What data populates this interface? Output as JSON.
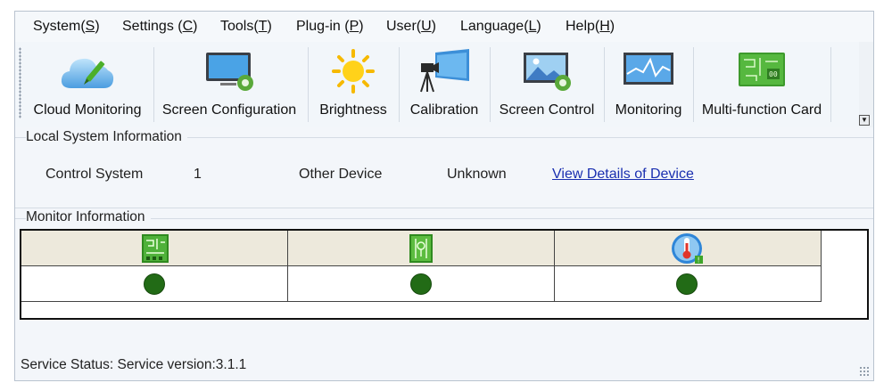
{
  "menu": [
    {
      "pre": "System(",
      "key": "S",
      "post": ")"
    },
    {
      "pre": "Settings (",
      "key": "C",
      "post": ")"
    },
    {
      "pre": "Tools(",
      "key": "T",
      "post": ")"
    },
    {
      "pre": "Plug-in (",
      "key": "P",
      "post": ")"
    },
    {
      "pre": "User(",
      "key": "U",
      "post": ")"
    },
    {
      "pre": "Language(",
      "key": "L",
      "post": ")"
    },
    {
      "pre": "Help(",
      "key": "H",
      "post": ")"
    }
  ],
  "toolbar": {
    "items": [
      {
        "label": "Cloud Monitoring",
        "icon": "cloud-pen-icon"
      },
      {
        "label": "Screen Configuration",
        "icon": "monitor-gear-icon"
      },
      {
        "label": "Brightness",
        "icon": "sun-icon"
      },
      {
        "label": "Calibration",
        "icon": "camera-tripod-icon"
      },
      {
        "label": "Screen Control",
        "icon": "picture-gear-icon"
      },
      {
        "label": "Monitoring",
        "icon": "waveform-monitor-icon"
      },
      {
        "label": "Multi-function Card",
        "icon": "circuit-board-icon"
      }
    ],
    "overflow_glyph": "▼"
  },
  "local_system": {
    "title": "Local System Information",
    "control_system_label": "Control System",
    "control_system_value": "1",
    "other_device_label": "Other Device",
    "other_device_value": "Unknown",
    "view_details_link": "View Details of Device"
  },
  "monitor": {
    "title": "Monitor Information",
    "columns": [
      {
        "icon": "receiving-card-icon"
      },
      {
        "icon": "power-module-icon"
      },
      {
        "icon": "thermometer-icon"
      }
    ],
    "status_color": "#226b16"
  },
  "status_bar": {
    "text": "Service Status:  Service version:3.1.1"
  }
}
